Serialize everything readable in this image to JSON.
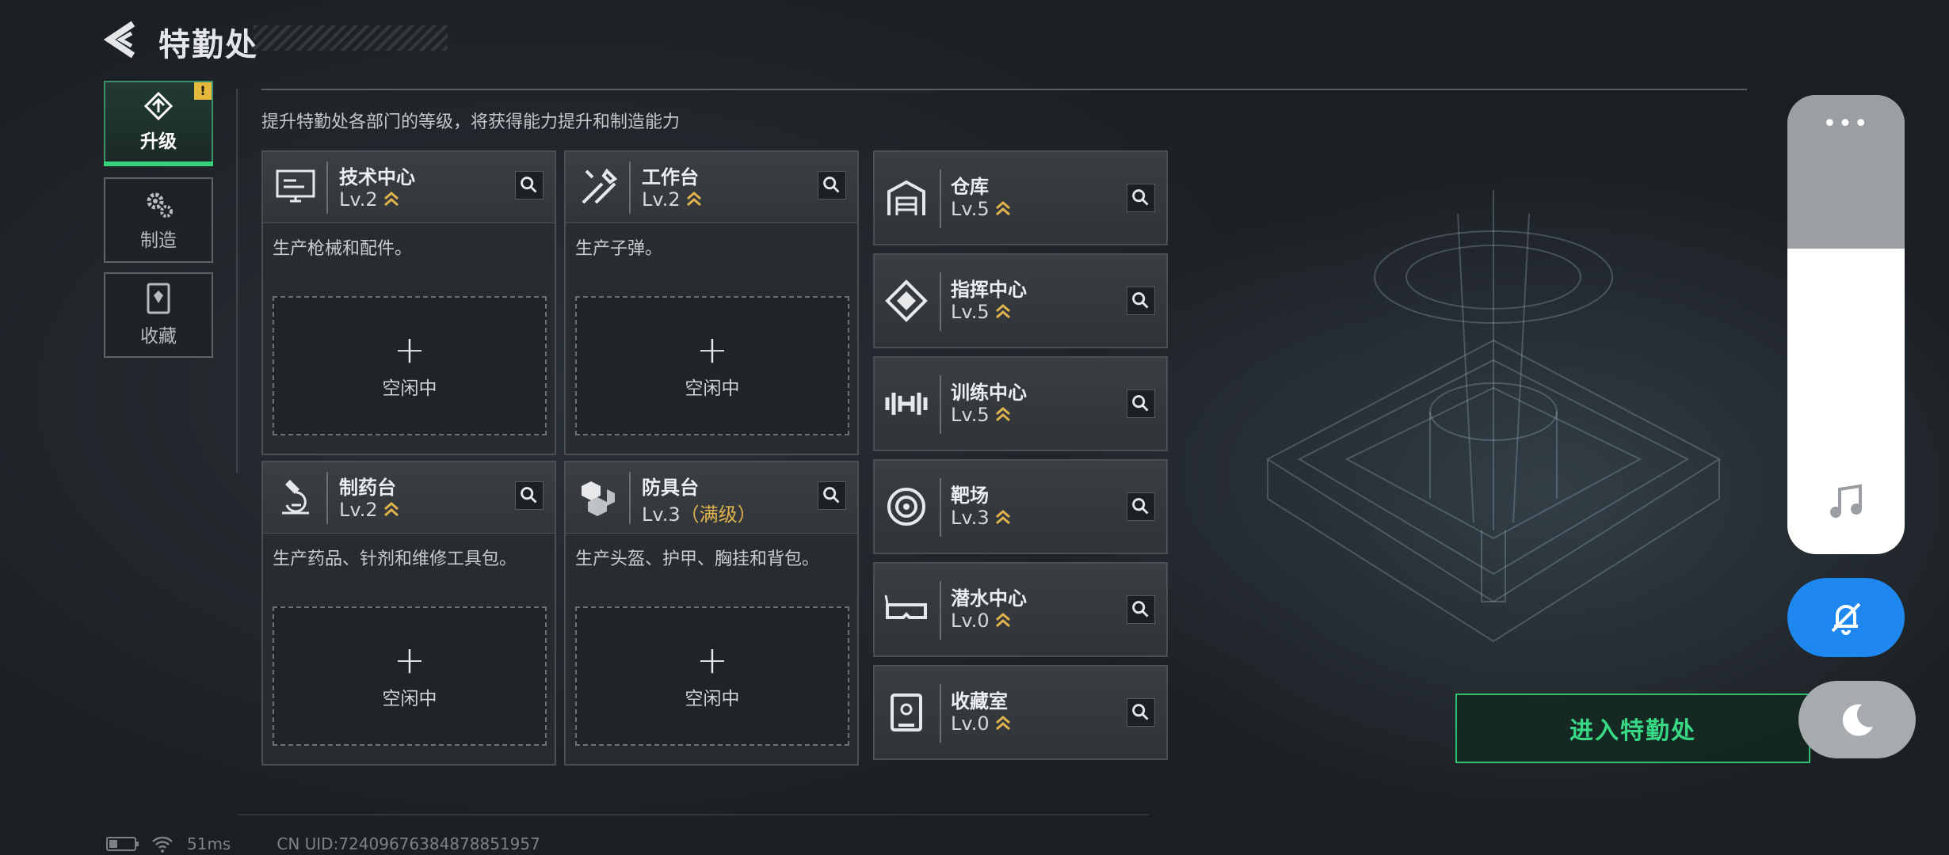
{
  "header": {
    "title": "特勤处",
    "back_icon": "back-arrow-icon"
  },
  "tabs": [
    {
      "label": "升级",
      "icon": "upgrade-icon",
      "active": true,
      "badge": "!"
    },
    {
      "label": "制造",
      "icon": "gear-icon",
      "active": false
    },
    {
      "label": "收藏",
      "icon": "collection-icon",
      "active": false
    }
  ],
  "subtitle": "提升特勤处各部门的等级，将获得能力提升和制造能力",
  "production_cards": [
    {
      "name": "技术中心",
      "level": "Lv.2",
      "max_label": "",
      "desc": "生产枪械和配件。",
      "slot_label": "空闲中",
      "icon": "computer-icon"
    },
    {
      "name": "工作台",
      "level": "Lv.2",
      "max_label": "",
      "desc": "生产子弹。",
      "slot_label": "空闲中",
      "icon": "tools-icon"
    },
    {
      "name": "制药台",
      "level": "Lv.2",
      "max_label": "",
      "desc": "生产药品、针剂和维修工具包。",
      "slot_label": "空闲中",
      "icon": "microscope-icon"
    },
    {
      "name": "防具台",
      "level": "Lv.3",
      "max_label": "（满级）",
      "desc": "生产头盔、护甲、胸挂和背包。",
      "slot_label": "空闲中",
      "icon": "armor-icon"
    }
  ],
  "facility_cards": [
    {
      "name": "仓库",
      "level": "Lv.5",
      "icon": "warehouse-icon"
    },
    {
      "name": "指挥中心",
      "level": "Lv.5",
      "icon": "chip-icon"
    },
    {
      "name": "训练中心",
      "level": "Lv.5",
      "icon": "dumbbell-icon"
    },
    {
      "name": "靶场",
      "level": "Lv.3",
      "icon": "target-icon"
    },
    {
      "name": "潜水中心",
      "level": "Lv.0",
      "icon": "diving-goggles-icon"
    },
    {
      "name": "收藏室",
      "level": "Lv.0",
      "icon": "display-case-icon"
    }
  ],
  "enter_button": "进入特勤处",
  "overlay": {
    "dots": "•••",
    "icons": [
      "music-note-icon",
      "mute-bell-icon",
      "moon-icon"
    ]
  },
  "status": {
    "ping": "51ms",
    "uid": "CN UID:72409676384878851957"
  },
  "colors": {
    "accent_green": "#38d17c",
    "level_up_gold": "#e0b44c",
    "mute_blue": "#1e88f0",
    "badge_yellow": "#e5b93b"
  }
}
